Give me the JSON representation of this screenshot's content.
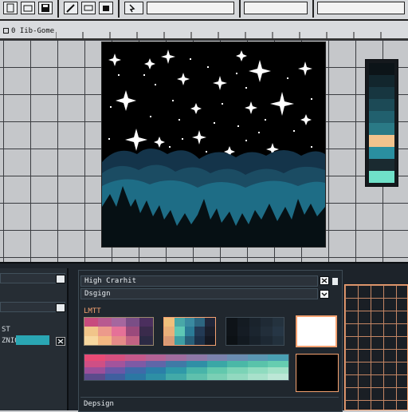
{
  "document": {
    "tab_title": "0 Iib-Gome"
  },
  "panel": {
    "palette_title": "High Crarhit",
    "section_design": "Dsgign",
    "section_list": "LMTT",
    "left_rows": [
      "",
      "ST",
      "ZNIO"
    ],
    "footer_label": "Depsign"
  },
  "icons": {
    "toolbar": [
      "new-icon",
      "open-icon",
      "save-icon",
      "pencil-icon",
      "eraser-icon",
      "fill-icon",
      "select-icon",
      "flip-icon",
      "move-icon"
    ],
    "panel": [
      "close-icon",
      "dropdown-icon"
    ]
  },
  "colors": {
    "sky": "#000000",
    "star": "#ffffff",
    "teal_hills": "#1e6d86",
    "tree": "#061014",
    "panel_bg": "#1d232a",
    "accent_orange": "#f4a271"
  },
  "swatches": {
    "strip": [
      "#0c1418",
      "#12262d",
      "#173640",
      "#1c4a56",
      "#21606e",
      "#2a7a86",
      "#f2c38d",
      "#2a8fa0",
      "#1a2a30",
      "#6fe0c8"
    ],
    "grid_a": [
      "#c84b7e",
      "#b85a90",
      "#a5679f",
      "#7a4e86",
      "#4b2f5e",
      "#f1c58a",
      "#ec9a8b",
      "#e57198",
      "#9a4a7c",
      "#3a2b4c",
      "#f7d8a0",
      "#f3b882",
      "#e58b88",
      "#c26283",
      "#2c2a44"
    ],
    "grid_b": [
      "#f0c07c",
      "#49a8a8",
      "#3a8aa0",
      "#2d6680",
      "#20263a",
      "#e9b07a",
      "#5ec8b5",
      "#2b7b96",
      "#233a55",
      "#1a1f2c",
      "#d99a76",
      "#3e9ea3",
      "#275e78",
      "#1c3048",
      "#141822"
    ],
    "grid_c": [
      "#0e1318",
      "#141b22",
      "#1a232c",
      "#1f2a35",
      "#24323e",
      "#0e1318",
      "#151c24",
      "#1b252f",
      "#222e3a",
      "#263645",
      "#0c1115",
      "#121920",
      "#18212a",
      "#1d2833",
      "#22303c"
    ],
    "gradient_rows": [
      [
        "#e94b76",
        "#d6507f",
        "#c5598b",
        "#b36396",
        "#a06d9f",
        "#8e78a7",
        "#7b83ae",
        "#6a8db2",
        "#5a97b3",
        "#4aa0b3"
      ],
      [
        "#cf4f85",
        "#a2549c",
        "#7e5aa5",
        "#5f66a8",
        "#3f7aa6",
        "#2f8fa6",
        "#3aa7a6",
        "#4ab8a7",
        "#59c3aa",
        "#66cdb0"
      ],
      [
        "#9c4f9a",
        "#6a58a7",
        "#3f6aa9",
        "#2b7fa8",
        "#2f99a8",
        "#48b4a9",
        "#62c8ad",
        "#7bd3b6",
        "#8fdbbf",
        "#a2e1c7"
      ],
      [
        "#5c4b8c",
        "#3f5f9f",
        "#2b77a3",
        "#2d8fa5",
        "#42aaa8",
        "#5fc0ad",
        "#7acfb5",
        "#92d9c0",
        "#a8e1cb",
        "#bce7d6"
      ]
    ]
  }
}
